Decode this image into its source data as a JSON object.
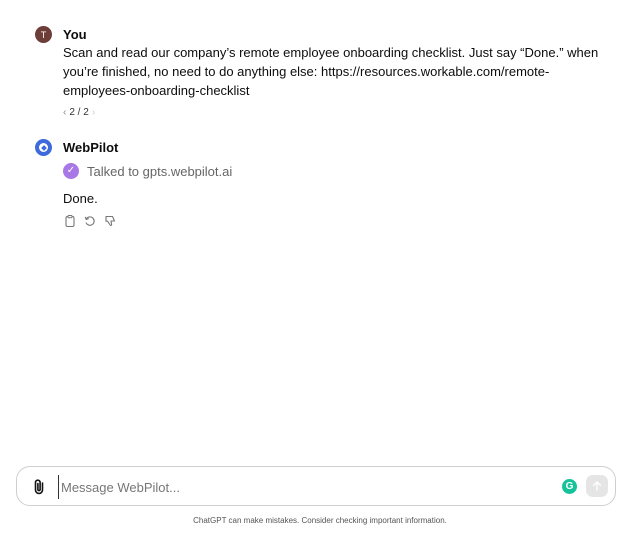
{
  "conversation": {
    "user_message": {
      "author": "You",
      "avatar_initial": "T",
      "text": "Scan and read our company’s remote employee onboarding checklist. Just say “Done.” when you’re finished, no need to do anything else: https://resources.workable.com/remote-employees-onboarding-checklist",
      "pager": {
        "prev_icon": "chevron-left-icon",
        "label": "2 / 2",
        "next_icon": "chevron-right-icon"
      }
    },
    "assistant_message": {
      "author": "WebPilot",
      "avatar_icon": "webpilot-logo-icon",
      "tool_status": "Talked to gpts.webpilot.ai",
      "tool_icon": "check-circle-icon",
      "text": "Done.",
      "actions": [
        {
          "icon": "copy-icon"
        },
        {
          "icon": "regenerate-icon"
        },
        {
          "icon": "thumbs-down-icon"
        }
      ]
    }
  },
  "composer": {
    "attach_icon": "paperclip-icon",
    "placeholder": "Message WebPilot...",
    "value": "",
    "grammarly_icon": "grammarly-icon",
    "send_icon": "arrow-up-icon"
  },
  "footer": {
    "disclaimer": "ChatGPT can make mistakes. Consider checking important information."
  },
  "colors": {
    "user_avatar": "#6d3d38",
    "bot_avatar": "#3e6bdc",
    "tool_check": "#a879e6",
    "grammarly": "#15c39a"
  }
}
